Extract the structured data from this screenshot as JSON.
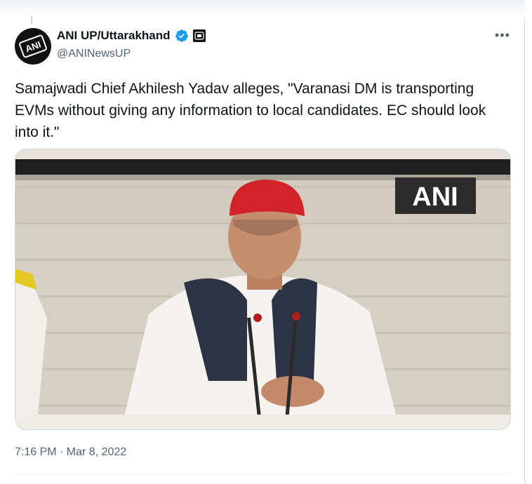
{
  "tweet": {
    "author_name": "ANI UP/Uttarakhand",
    "handle": "@ANINewsUP",
    "avatar_text": "ANI",
    "text": "Samajwadi Chief Akhilesh Yadav alleges, \"Varanasi DM is transporting EVMs without giving any information to local candidates. EC should look into it.\"",
    "media_watermark": "ANI",
    "timestamp": "7:16 PM · Mar 8, 2022",
    "more_label": "•••"
  },
  "icons": {
    "verified": "verified-badge-icon",
    "affiliate": "ani-affiliate-badge-icon",
    "more": "more-options-icon"
  },
  "colors": {
    "verified_blue": "#1d9bf0",
    "muted_text": "#536471",
    "text": "#0f1419"
  }
}
